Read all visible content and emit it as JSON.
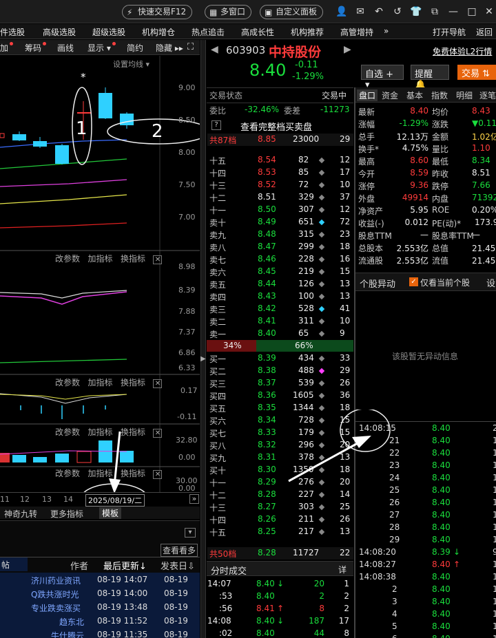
{
  "titlebar": {
    "quick_trade": "快速交易F12",
    "multi_window": "多窗口",
    "custom_panel": "自定义面板",
    "icons": [
      "user-icon",
      "mail-icon",
      "undo-icon",
      "back-icon",
      "shirt-icon",
      "restore-icon",
      "minimize-icon",
      "maximize-icon",
      "close-icon"
    ]
  },
  "menu": {
    "items": [
      "件选股",
      "高级选股",
      "超级选股",
      "机构增仓",
      "热点追击",
      "高成长性",
      "机构推荐",
      "高管增持"
    ],
    "more": "»",
    "nav": "打开导航",
    "back": "返回"
  },
  "left_toolbar": {
    "items": [
      "加",
      "筹码",
      "画线",
      "显示",
      "简约",
      "隐藏"
    ],
    "settings": "设置均线"
  },
  "kline": {
    "y_ticks": [
      "9.00",
      "8.50",
      "8.00",
      "7.50",
      "7.00"
    ],
    "annotations": [
      "1",
      "2"
    ],
    "star": "*"
  },
  "panels": [
    {
      "controls": [
        "改参数",
        "加指标",
        "换指标"
      ],
      "y_ticks": [
        "8.98",
        "8.39",
        "7.88",
        "7.37",
        "6.86",
        "6.33"
      ]
    },
    {
      "controls": [
        "改参数",
        "加指标",
        "换指标"
      ],
      "y_ticks": [
        "0.17",
        "-0.11"
      ]
    },
    {
      "controls": [
        "改参数",
        "加指标",
        "换指标"
      ],
      "y_ticks": [
        "32.80",
        "0.00"
      ]
    },
    {
      "controls": [
        "改参数",
        "加指标",
        "换指标"
      ],
      "y_ticks": [
        "30.00",
        "0.00"
      ]
    }
  ],
  "date_axis": {
    "dates": [
      "11",
      "12",
      "13",
      "14"
    ],
    "current": "2025/08/19/二"
  },
  "bottom_tabs": [
    "神奇九转",
    "更多指标",
    "模板"
  ],
  "news": {
    "view_more": "查看看多",
    "headers": [
      "帖",
      "作者",
      "最后更新",
      "发表日"
    ],
    "rows": [
      {
        "author": "济川药业资讯",
        "updated": "08-19 14:07",
        "posted": "08-19"
      },
      {
        "author": "Q跌共涨时光",
        "updated": "08-19 14:00",
        "posted": "08-19"
      },
      {
        "author": "专业跌卖涨买",
        "updated": "08-19 13:48",
        "posted": "08-19"
      },
      {
        "author": "趋东北",
        "updated": "08-19 11:52",
        "posted": "08-19"
      },
      {
        "author": "牛仕腾云",
        "updated": "08-19 11:35",
        "posted": "08-19"
      }
    ]
  },
  "stock": {
    "code": "603903",
    "name": "中持股份",
    "price": "8.40",
    "change": "-0.11",
    "change_pct": "-1.29%",
    "free_trial": "免费体验L2行情",
    "watchlist": "自选",
    "alert": "提醒",
    "trade": "交易"
  },
  "orderbook": {
    "status_label": "交易状态",
    "status_value": "交易中",
    "weibi_label": "委比",
    "weibi_value": "-32.46%",
    "weicha_label": "委差",
    "weicha_value": "-11273",
    "full_book": "查看完整档买卖盘",
    "help": "?",
    "total87_label": "共87档",
    "total87_price": "8.85",
    "total87_vol": "23000",
    "total87_n": "29",
    "asks": [
      {
        "label": "十五",
        "price": "8.54",
        "vol": "82",
        "n": "12"
      },
      {
        "label": "十四",
        "price": "8.53",
        "vol": "85",
        "n": "17"
      },
      {
        "label": "十三",
        "price": "8.52",
        "vol": "72",
        "n": "10"
      },
      {
        "label": "十二",
        "price": "8.51",
        "vol": "329",
        "n": "37"
      },
      {
        "label": "十一",
        "price": "8.50",
        "vol": "307",
        "n": "12"
      },
      {
        "label": "卖十",
        "price": "8.49",
        "vol": "651",
        "n": "72"
      },
      {
        "label": "卖九",
        "price": "8.48",
        "vol": "315",
        "n": "23"
      },
      {
        "label": "卖八",
        "price": "8.47",
        "vol": "299",
        "n": "18"
      },
      {
        "label": "卖七",
        "price": "8.46",
        "vol": "228",
        "n": "16"
      },
      {
        "label": "卖六",
        "price": "8.45",
        "vol": "219",
        "n": "15"
      },
      {
        "label": "卖五",
        "price": "8.44",
        "vol": "126",
        "n": "13"
      },
      {
        "label": "卖四",
        "price": "8.43",
        "vol": "100",
        "n": "13"
      },
      {
        "label": "卖三",
        "price": "8.42",
        "vol": "528",
        "n": "41"
      },
      {
        "label": "卖二",
        "price": "8.41",
        "vol": "311",
        "n": "10"
      },
      {
        "label": "卖一",
        "price": "8.40",
        "vol": "65",
        "n": "9"
      }
    ],
    "ratio_left": "34%",
    "ratio_right": "66%",
    "ratio_left_value": 0.34,
    "bids": [
      {
        "label": "买一",
        "price": "8.39",
        "vol": "434",
        "n": "33"
      },
      {
        "label": "买二",
        "price": "8.38",
        "vol": "488",
        "n": "29"
      },
      {
        "label": "买三",
        "price": "8.37",
        "vol": "539",
        "n": "26"
      },
      {
        "label": "买四",
        "price": "8.36",
        "vol": "1605",
        "n": "36"
      },
      {
        "label": "买五",
        "price": "8.35",
        "vol": "1344",
        "n": "18"
      },
      {
        "label": "买六",
        "price": "8.34",
        "vol": "728",
        "n": "15"
      },
      {
        "label": "买七",
        "price": "8.33",
        "vol": "179",
        "n": "15"
      },
      {
        "label": "买八",
        "price": "8.32",
        "vol": "296",
        "n": "20"
      },
      {
        "label": "买九",
        "price": "8.31",
        "vol": "378",
        "n": "13"
      },
      {
        "label": "买十",
        "price": "8.30",
        "vol": "1350",
        "n": "18"
      },
      {
        "label": "十一",
        "price": "8.29",
        "vol": "276",
        "n": "20"
      },
      {
        "label": "十二",
        "price": "8.28",
        "vol": "227",
        "n": "14"
      },
      {
        "label": "十三",
        "price": "8.27",
        "vol": "303",
        "n": "25"
      },
      {
        "label": "十四",
        "price": "8.26",
        "vol": "211",
        "n": "26"
      },
      {
        "label": "十五",
        "price": "8.25",
        "vol": "217",
        "n": "13"
      }
    ],
    "total50_label": "共50档",
    "total50_price": "8.28",
    "total50_vol": "11727",
    "total50_n": "22"
  },
  "ticks_section": {
    "title": "分时成交",
    "detail": "详",
    "rows": [
      {
        "time": "14:07",
        "price": "8.40",
        "dir": "down",
        "vol": "20",
        "n": "1"
      },
      {
        "time": ":53",
        "price": "8.40",
        "dir": "",
        "vol": "2",
        "n": "2"
      },
      {
        "time": ":56",
        "price": "8.41",
        "dir": "up",
        "vol": "8",
        "n": "2"
      },
      {
        "time": "14:08",
        "price": "8.40",
        "dir": "down",
        "vol": "187",
        "n": "17"
      },
      {
        "time": ":02",
        "price": "8.40",
        "dir": "",
        "vol": "44",
        "n": "8"
      }
    ]
  },
  "quote_tabs": [
    "盘口",
    "资金",
    "基本",
    "指数",
    "明细",
    "逐笔"
  ],
  "quote": [
    {
      "l1": "最新",
      "v1": "8.40",
      "c1": "red",
      "l2": "均价",
      "v2": "8.43",
      "c2": "red"
    },
    {
      "l1": "涨幅",
      "v1": "-1.29%",
      "c1": "green",
      "l2": "涨跌",
      "v2": "▼0.11",
      "c2": "green"
    },
    {
      "l1": "总手",
      "v1": "12.13万",
      "c1": "white",
      "l2": "金额",
      "v2": "1.02亿",
      "c2": "yellow"
    },
    {
      "l1": "换手*",
      "v1": "4.75%",
      "c1": "white",
      "l2": "量比",
      "v2": "1.10",
      "c2": "red"
    },
    {
      "l1": "最高",
      "v1": "8.60",
      "c1": "red",
      "l2": "最低",
      "v2": "8.34",
      "c2": "green"
    },
    {
      "l1": "今开",
      "v1": "8.59",
      "c1": "red",
      "l2": "昨收",
      "v2": "8.51",
      "c2": "white"
    },
    {
      "l1": "涨停",
      "v1": "9.36",
      "c1": "red",
      "l2": "跌停",
      "v2": "7.66",
      "c2": "green"
    },
    {
      "l1": "外盘",
      "v1": "49914",
      "c1": "red",
      "l2": "内盘",
      "v2": "71392",
      "c2": "green"
    },
    {
      "l1": "净资产",
      "v1": "5.95",
      "c1": "white",
      "l2": "ROE",
      "v2": "0.20%",
      "c2": "white"
    },
    {
      "l1": "收益(-)",
      "v1": "0.012",
      "c1": "white",
      "l2": "PE(动)*",
      "v2": "173.90",
      "c2": "white"
    },
    {
      "l1": "股息TTM",
      "v1": "—",
      "c1": "white",
      "l2": "股息率TTM",
      "v2": "—",
      "c2": "white"
    },
    {
      "l1": "总股本",
      "v1": "2.553亿",
      "c1": "white",
      "l2": "总值",
      "v2": "21.45亿",
      "c2": "white"
    },
    {
      "l1": "流通股",
      "v1": "2.553亿",
      "c1": "white",
      "l2": "流值",
      "v2": "21.45亿",
      "c2": "white"
    }
  ],
  "abnormal": {
    "title": "个股异动",
    "only_current": "仅看当前个股",
    "settings": "设",
    "empty": "该股暂无异动信息"
  },
  "tick_detail": [
    {
      "time": "14:08:15",
      "price": "8.40",
      "dir": "",
      "vol": "2"
    },
    {
      "time": "21",
      "price": "8.40",
      "dir": "",
      "vol": "1"
    },
    {
      "time": "22",
      "price": "8.40",
      "dir": "",
      "vol": "1"
    },
    {
      "time": "23",
      "price": "8.40",
      "dir": "",
      "vol": "1"
    },
    {
      "time": "24",
      "price": "8.40",
      "dir": "",
      "vol": "1"
    },
    {
      "time": "25",
      "price": "8.40",
      "dir": "",
      "vol": "1"
    },
    {
      "time": "26",
      "price": "8.40",
      "dir": "",
      "vol": "1"
    },
    {
      "time": "27",
      "price": "8.40",
      "dir": "",
      "vol": "1"
    },
    {
      "time": "28",
      "price": "8.40",
      "dir": "",
      "vol": "1"
    },
    {
      "time": "29",
      "price": "8.40",
      "dir": "",
      "vol": "1"
    },
    {
      "time": "14:08:20",
      "price": "8.39",
      "dir": "down",
      "vol": "9"
    },
    {
      "time": "14:08:27",
      "price": "8.40",
      "dir": "up",
      "vol": "1"
    },
    {
      "time": "14:08:38",
      "price": "8.40",
      "dir": "",
      "vol": "1"
    },
    {
      "time": "2",
      "price": "8.40",
      "dir": "",
      "vol": "1"
    },
    {
      "time": "3",
      "price": "8.40",
      "dir": "",
      "vol": "1"
    },
    {
      "time": "4",
      "price": "8.40",
      "dir": "",
      "vol": "1"
    },
    {
      "time": "5",
      "price": "8.40",
      "dir": "",
      "vol": "1"
    },
    {
      "time": "6",
      "price": "8.40",
      "dir": "",
      "vol": "1"
    }
  ]
}
